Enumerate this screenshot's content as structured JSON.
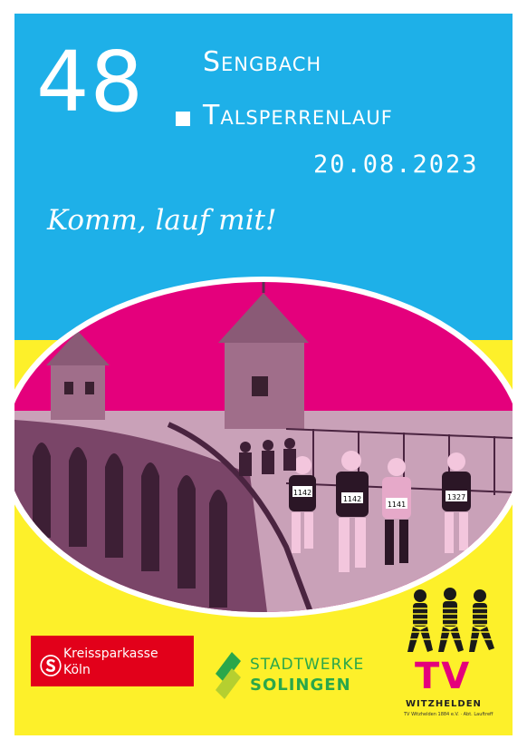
{
  "event": {
    "edition_number": "48",
    "title_line1": "Sengbach",
    "title_line2": "Talsperrenlauf",
    "date": "20.08.2023",
    "slogan": "Komm, lauf mit!"
  },
  "photo": {
    "bib_numbers": [
      "1142",
      "1142",
      "1141",
      "1327"
    ]
  },
  "sponsors": {
    "kreissparkasse": {
      "line1": "Kreissparkasse",
      "line2": "Köln",
      "icon": "sparkasse-s-icon"
    },
    "stadtwerke": {
      "line1": "STADTWERKE",
      "line2": "SOLINGEN",
      "icon": "stadtwerke-leaf-icon"
    },
    "tv": {
      "letters": "TV",
      "name": "WITZHELDEN",
      "subtitle": "TV Witzhelden 1884 e.V. · Abt. Lauftreff"
    }
  },
  "colors": {
    "cyan": "#1eb0e8",
    "yellow": "#fdf02a",
    "magenta": "#e4007c",
    "sparkasse_red": "#e2001a",
    "stadtwerke_green": "#2aa74a"
  }
}
